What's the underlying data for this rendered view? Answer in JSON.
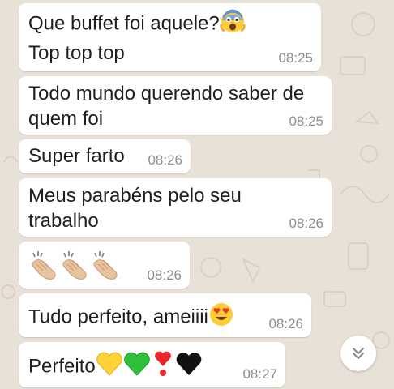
{
  "messages": [
    {
      "lines": [
        "Que buffet foi aquele?",
        "Top top top"
      ],
      "emoji": [
        "scared-face"
      ],
      "time": "08:25"
    },
    {
      "lines": [
        "Todo mundo querendo saber de",
        "quem foi"
      ],
      "time": "08:25"
    },
    {
      "lines": [
        "Super farto"
      ],
      "time": "08:26"
    },
    {
      "lines": [
        "Meus parabéns pelo seu",
        "trabalho"
      ],
      "time": "08:26"
    },
    {
      "lines": [],
      "emoji": [
        "clapping-hands",
        "clapping-hands",
        "clapping-hands"
      ],
      "time": "08:26"
    },
    {
      "lines": [
        "Tudo perfeito, ameiiii"
      ],
      "emoji": [
        "heart-eyes-face"
      ],
      "time": "08:26"
    },
    {
      "lines": [
        "Perfeito"
      ],
      "emoji": [
        "yellow-heart",
        "green-heart",
        "red-exclamation-heart",
        "black-heart"
      ],
      "time": "08:27"
    }
  ],
  "scroll_button": {
    "icon": "double-chevron-down-icon"
  },
  "colors": {
    "wallpaper": "#e8e1d7",
    "bubble": "#ffffff",
    "timestamp": "#8e8e8e",
    "text": "#1e1e1e"
  }
}
